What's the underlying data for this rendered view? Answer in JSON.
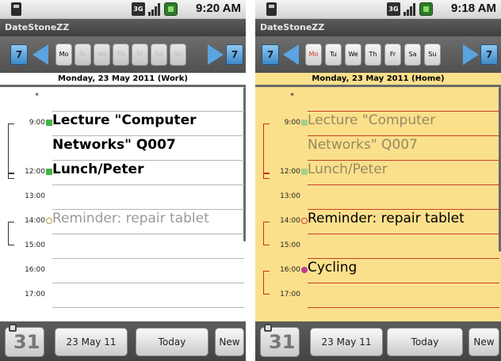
{
  "screens": [
    {
      "status_time": "9:20 AM",
      "network": "3G",
      "app_title": "DateStoneZZ",
      "nav_prev_label": "7",
      "nav_next_label": "7",
      "days": [
        "Mo",
        "Tu",
        "We",
        "Th",
        "Fr",
        "Sa",
        "Su"
      ],
      "date_header": "Monday, 23 May 2011 (Work)",
      "all_day_marker": "*",
      "times": [
        "9:00",
        "12:00",
        "13:00",
        "14:00",
        "15:00",
        "16:00",
        "17:00"
      ],
      "events": [
        {
          "title_line1": "Lecture \"Computer",
          "title_line2": "Networks\" Q007"
        },
        {
          "title": "Lunch/Peter"
        },
        {
          "title": "Reminder: repair tablet"
        }
      ],
      "bottom": {
        "calendar_icon_day": "31",
        "date_button": "23 May 11",
        "today_button": "Today",
        "new_button": "New"
      }
    },
    {
      "status_time": "9:18 AM",
      "network": "3G",
      "app_title": "DateStoneZZ",
      "nav_prev_label": "7",
      "nav_next_label": "7",
      "days": [
        "Mo",
        "Tu",
        "We",
        "Th",
        "Fr",
        "Sa",
        "Su"
      ],
      "date_header": "Monday, 23 May 2011 (Home)",
      "all_day_marker": "*",
      "times": [
        "9:00",
        "12:00",
        "13:00",
        "14:00",
        "15:00",
        "16:00",
        "17:00"
      ],
      "events": [
        {
          "title_line1": "Lecture \"Computer",
          "title_line2": "Networks\" Q007"
        },
        {
          "title": "Lunch/Peter"
        },
        {
          "title": "Reminder: repair tablet"
        },
        {
          "title": "Cycling"
        }
      ],
      "bottom": {
        "calendar_icon_day": "31",
        "date_button": "23 May 11",
        "today_button": "Today",
        "new_button": "New"
      }
    }
  ],
  "colors": {
    "home_background": "#fbe08c",
    "home_rule": "#c64024",
    "event_marker_green": "#43b543",
    "event_marker_magenta": "#c03a9a",
    "nav_blue": "#5aa4e1"
  }
}
